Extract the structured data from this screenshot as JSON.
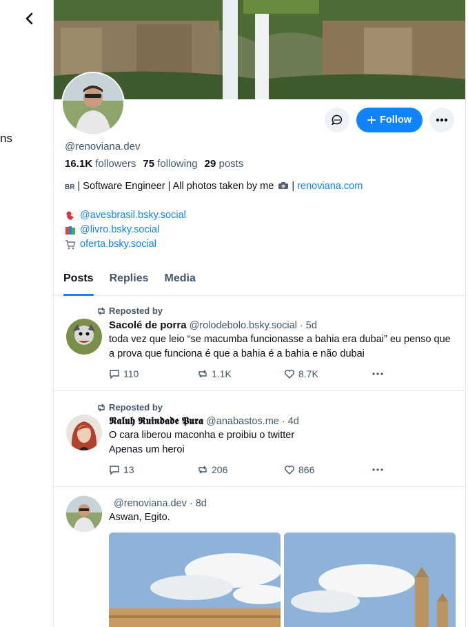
{
  "nav": {
    "back_icon": "chevron-left-icon",
    "clipped_label": "ns"
  },
  "profile": {
    "handle": "@renoviana.dev",
    "followers_count": "16.1K",
    "followers_label": "followers",
    "following_count": "75",
    "following_label": "following",
    "posts_count": "29",
    "posts_label": "posts",
    "bio_flag": "BR",
    "bio_text": "| Software Engineer | All photos taken by me",
    "bio_sep": "|",
    "bio_link": "renoviana.com",
    "links": [
      {
        "icon": "bird-icon",
        "text": "@avesbrasil.bsky.social"
      },
      {
        "icon": "books-icon",
        "text": "@livro.bsky.social"
      },
      {
        "icon": "cart-icon",
        "text": "oferta.bsky.social"
      }
    ],
    "follow_label": "Follow"
  },
  "tabs": [
    "Posts",
    "Replies",
    "Media"
  ],
  "posts": [
    {
      "reposted_by": "Reposted by",
      "name": "Sacolé de porra",
      "handle": "@rolodebolo.bsky.social",
      "time": "· 5d",
      "text": "toda vez que leio “se macumba funcionasse a bahia era dubai” eu penso que a prova que funciona é que a bahia é a bahia e não dubai",
      "replies": "110",
      "reposts": "1.1K",
      "likes": "8.7K"
    },
    {
      "reposted_by": "Reposted by",
      "name": "𝕹𝖆𝖑𝖚𝖍 𝕽𝖚𝖎𝖓𝖉𝖆𝖉𝖊 𝕻𝖚𝖗𝖆",
      "handle": "@anabastos.me",
      "time": "· 4d",
      "text_line1": "O cara liberou maconha e proibiu o twitter",
      "text_line2": "Apenas um heroi",
      "replies": "13",
      "reposts": "206",
      "likes": "866"
    },
    {
      "handle": "@renoviana.dev",
      "time": "· 8d",
      "text": "Aswan, Egito."
    }
  ],
  "colors": {
    "accent": "#1083fe",
    "muted": "#42576c",
    "border": "#e3e8ee"
  }
}
